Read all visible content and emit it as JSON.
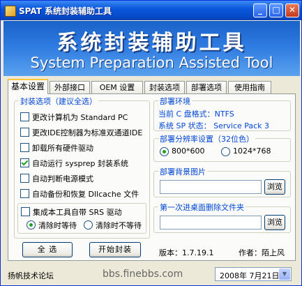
{
  "window": {
    "title": "SPAT  系统封装辅助工具",
    "minimize_glyph": "_",
    "maximize_glyph": "□",
    "close_glyph": "✕"
  },
  "banner": {
    "title": "系统封装辅助工具",
    "subtitle": "System Preparation Assisted Tool"
  },
  "tabs": [
    {
      "label": "基本设置",
      "active": true
    },
    {
      "label": "外部接口"
    },
    {
      "label": "OEM 设置"
    },
    {
      "label": "封装选项"
    },
    {
      "label": "部署选项"
    },
    {
      "label": "使用指南"
    }
  ],
  "left_group": {
    "title": "封装选项（建议全选）",
    "options": [
      {
        "label": "更改计算机为 Standard PC",
        "checked": false
      },
      {
        "label": "更改IDE控制器为标准双通道IDE",
        "checked": false
      },
      {
        "label": "卸载所有硬件驱动",
        "checked": false
      },
      {
        "label": "自动运行 sysprep 封装系统",
        "checked": true
      },
      {
        "label": "自动判断电源模式",
        "checked": false
      },
      {
        "label": "自动备份和恢复 Dllcache 文件",
        "checked": false
      }
    ],
    "srs": {
      "label": "集成本工具自带 SRS 驱动",
      "checked": false,
      "radio_wait": "清除时等待",
      "radio_nowait": "清除时不等待",
      "selected": "wait"
    },
    "select_all_button": "全 选",
    "start_button": "开始封装"
  },
  "deploy_env": {
    "title": "部署环境",
    "disk_format": "当前 C 盘格式：NTFS",
    "sp_status": "系统 SP 状态：  Service Pack 3"
  },
  "resolution": {
    "title": "部署分辨率设置（32位色）",
    "option1": "800*600",
    "option2": "1024*768",
    "selected": "800*600"
  },
  "background": {
    "title": "部署背景图片",
    "value": "",
    "browse": "浏览"
  },
  "desktop_folder": {
    "title": "第一次进桌面删除文件夹",
    "value": "",
    "browse": "浏览"
  },
  "version": "版本：1.7.19.1",
  "author": "作者：陌上风",
  "status": {
    "forum": "扬帆技术论坛",
    "url": "bbs.finebbs.com",
    "date": "2008年  7月21日",
    "date_dropdown_glyph": "▼"
  }
}
